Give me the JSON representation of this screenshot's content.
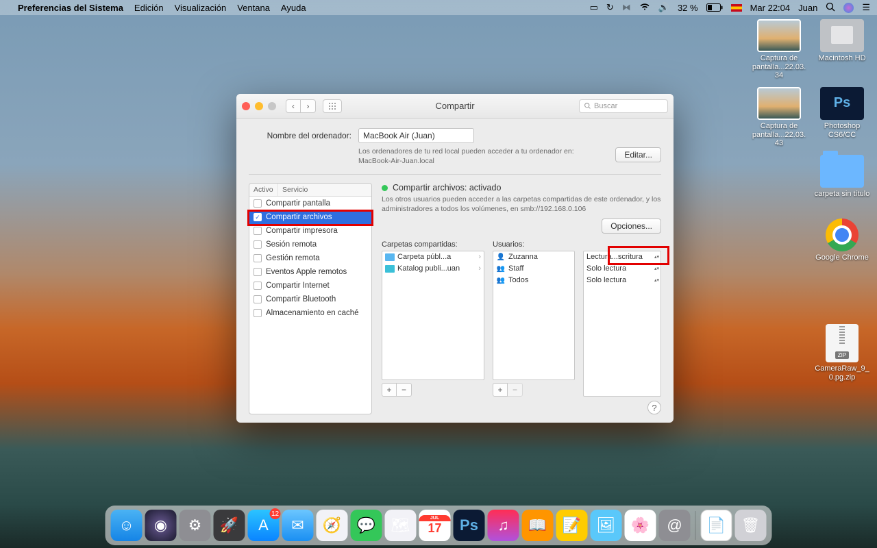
{
  "menubar": {
    "appname": "Preferencias del Sistema",
    "items": [
      "Edición",
      "Visualización",
      "Ventana",
      "Ayuda"
    ],
    "battery_pct": "32 %",
    "clock": "Mar 22:04",
    "user": "Juan"
  },
  "desktop": {
    "item1": "Captura de pantalla...22.03.34",
    "item2": "Macintosh HD",
    "item3": "Captura de pantalla...22.03.43",
    "item4": "Photoshop CS6/CC",
    "item5": "carpeta sin título",
    "item6": "Google Chrome",
    "item7": "CameraRaw_9_0.pg.zip",
    "zip_tag": "ZIP"
  },
  "window": {
    "title": "Compartir",
    "search_placeholder": "Buscar",
    "computer_label": "Nombre del ordenador:",
    "computer_name": "MacBook Air (Juan)",
    "computer_desc1": "Los ordenadores de tu red local pueden acceder a tu ordenador en:",
    "computer_desc2": "MacBook-Air-Juan.local",
    "edit_btn": "Editar...",
    "services_headers": {
      "c1": "Activo",
      "c2": "Servicio"
    },
    "services": [
      {
        "label": "Compartir pantalla",
        "checked": false
      },
      {
        "label": "Compartir archivos",
        "checked": true,
        "selected": true
      },
      {
        "label": "Compartir impresora",
        "checked": false
      },
      {
        "label": "Sesión remota",
        "checked": false
      },
      {
        "label": "Gestión remota",
        "checked": false
      },
      {
        "label": "Eventos Apple remotos",
        "checked": false
      },
      {
        "label": "Compartir Internet",
        "checked": false
      },
      {
        "label": "Compartir Bluetooth",
        "checked": false
      },
      {
        "label": "Almacenamiento en caché",
        "checked": false
      }
    ],
    "status_title": "Compartir archivos: activado",
    "status_desc": "Los otros usuarios pueden acceder a las carpetas compartidas de este ordenador, y los administradores a todos los volúmenes, en smb://192.168.0.106",
    "options_btn": "Opciones...",
    "folders_header": "Carpetas compartidas:",
    "folders": [
      {
        "label": "Carpeta públ...a"
      },
      {
        "label": "Katalog publi...uan"
      }
    ],
    "users_header": "Usuarios:",
    "users": [
      {
        "icon": "single",
        "label": "Zuzanna"
      },
      {
        "icon": "group",
        "label": "Staff"
      },
      {
        "icon": "group",
        "label": "Todos"
      }
    ],
    "perms": [
      "Lectura...scritura",
      "Solo lectura",
      "Solo lectura"
    ]
  },
  "dock": {
    "appstore_badge": "12",
    "cal_month": "JUL",
    "cal_day": "17"
  }
}
